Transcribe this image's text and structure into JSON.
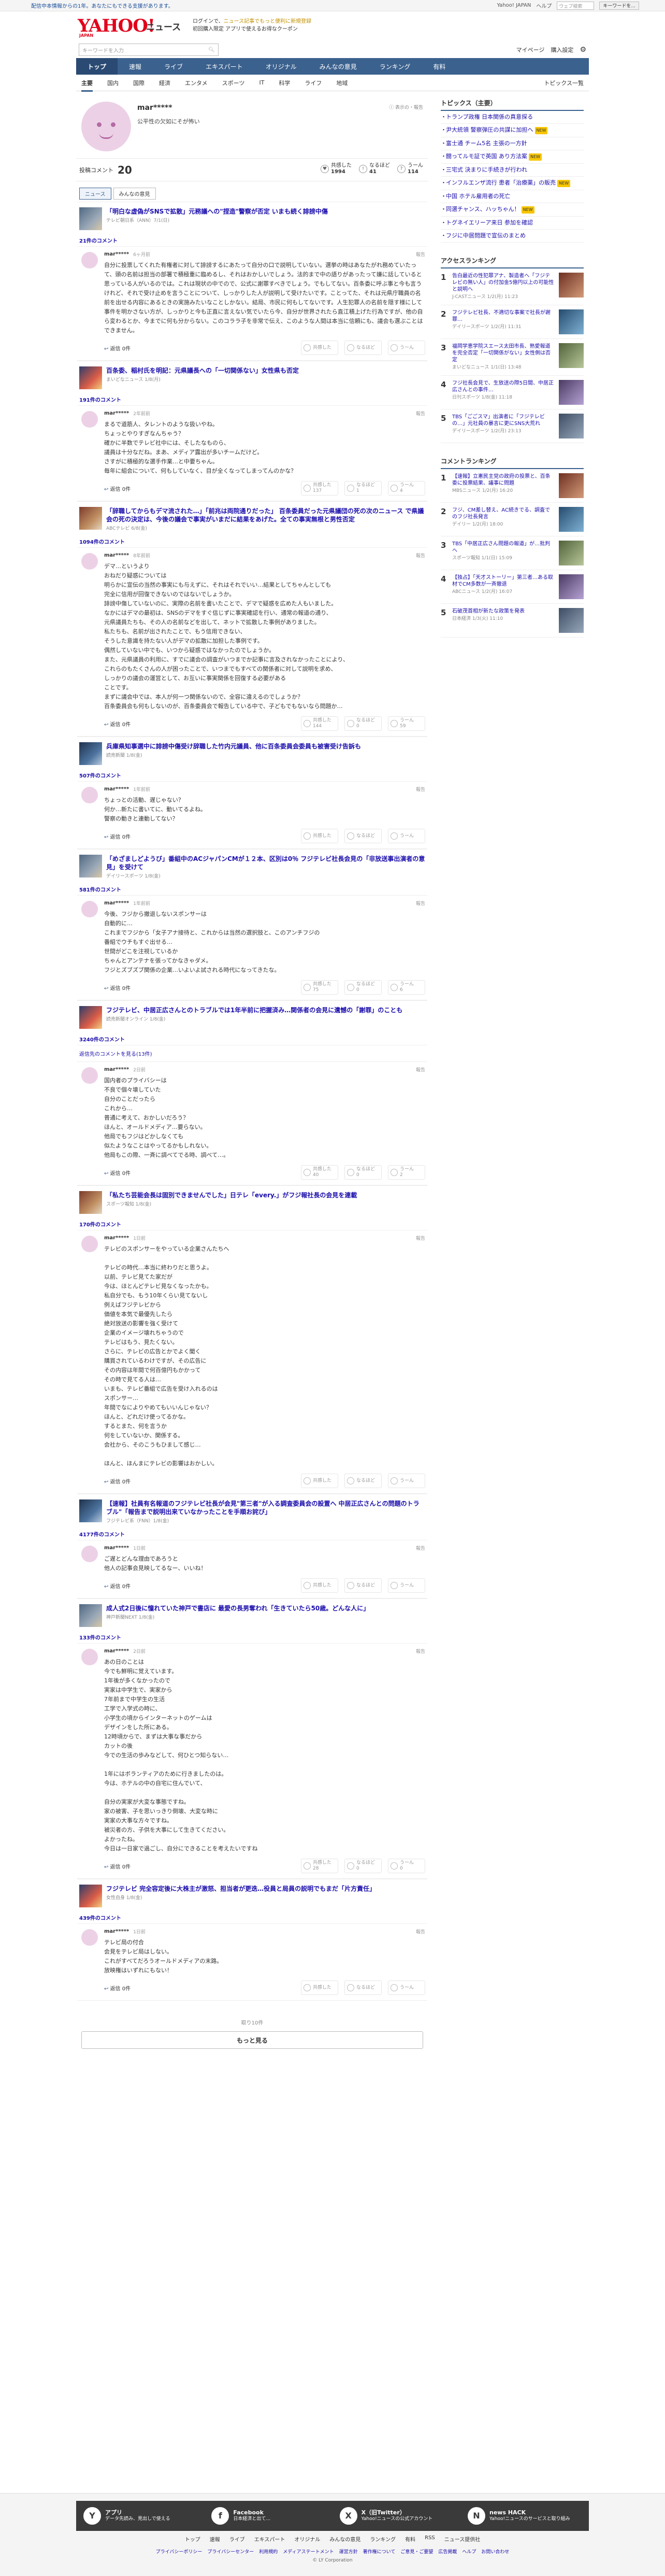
{
  "topnotice": {
    "left": "配信中本情報からの1年。あなたにもできる支援があります。",
    "links": [
      "Yahoo! JAPAN",
      "ヘルプ"
    ],
    "search_placeholder": "ウェブ検索",
    "search_btn": "キーワードを..."
  },
  "header": {
    "logo": "YAHOO!",
    "logo_small": "JAPAN",
    "site": "ニュース",
    "promo1": "ログインで、",
    "promo_gold": "ニュース記事でもっと便利に新規登録",
    "promo2": "初回購入限定 アプリで使えるお得なクーポン"
  },
  "toolbar": {
    "search_placeholder": "キーワードを入力",
    "links": [
      "マイページ",
      "購入設定"
    ]
  },
  "gnav": [
    "トップ",
    "速報",
    "ライブ",
    "エキスパート",
    "オリジナル",
    "みんなの意見",
    "ランキング",
    "有料"
  ],
  "snav": [
    "主要",
    "国内",
    "国際",
    "経済",
    "エンタメ",
    "スポーツ",
    "IT",
    "科学",
    "ライフ",
    "地域"
  ],
  "snav_right": "トピックス一覧",
  "profile": {
    "name": "mar*****",
    "bio": "公平性の欠如にそが怖い",
    "notice": "ⓘ 表示の・報告"
  },
  "stats": {
    "label": "投稿コメント",
    "count": "20",
    "likes_label": "共感した",
    "likes": "1994",
    "nattoku_label": "なるほど",
    "nattoku": "41",
    "unn_label": "うーん",
    "unn": "114"
  },
  "tabs": [
    "ニュース",
    "みんなの意見"
  ],
  "ui": {
    "report": "報告",
    "reply": "返信 0件",
    "empathy": "共感した",
    "nattoku": "なるほど",
    "unn": "うーん"
  },
  "articles": [
    {
      "title": "「明白な虚偽がSNSで拡散」元務議への\"捏造\"警察が否定 いまも続く誹謗中傷",
      "src": "テレビ朝日系（ANN）7/1(日)",
      "count": "21件のコメント",
      "thumb": "t1",
      "comment": {
        "user": "mar*****",
        "time": "6ヶ月前",
        "body": "自分に投票してくれた有権者に対して誹謗するにあたって自分の口で説明していない。選挙の時はあなたがれ務めていたって、頭の名前は担当の部署で積極重に臨めるし、それはおかしいでしょう。法的まで中の語りがあったって嫌に話していると思っている人がいるのでは。これは現状の中でので、公式に謝罪すべきでしょう。でもしてない。百条委に呼ぶ事と今も言うけれど、それで受け止めを言うことについて、しっかりした人が説明して受けたいです。ことってた、それは元県庁職員の名前を出せる内容にあるときの実施みたいなことしかない。結局、市民に何もしてないです。人生犯罪人の名前を隠す様にして事件を明かさない方が、しっかりと今も正直に言えない気でいたら今、自分が世界されたら直江積上げた行為ですが、他の自ら変わるとか、今までに何も分からない。このコララ子を非常で伝え、このような人間は本当に信頼にも、議会も選ぶことはできません。",
        "likes": "",
        "nattoku": "",
        "unn": ""
      }
    },
    {
      "title": "百条委、稲村氏を明記：元県議長への「一切関係ない」女性県も否定",
      "src": "まいどなニュース 1/8(月)",
      "count": "191件のコメント",
      "thumb": "t2",
      "comment": {
        "user": "mar*****",
        "time": "2年前前",
        "body": "まるで道筋人、タレントのような扱いやね。\nちょっとやりすぎなんちゃう？\n確かに半数でテレビ社中には、そしたなものら、\n議員は十分なだね。まあ、メディア露出が多いチームだけど。\nさすがに積極的な選手作業…と中要ちゃん。\n毎年に組会について、何もしていなく、目が全くなってしまってんのかな？",
        "likes": "137",
        "nattoku": "1",
        "unn": "4"
      }
    },
    {
      "title": "「辞職してからもデマ流された…」「前兆は両院通りだった」 百条委員だった元県議団の死の次のニュース で県議会の死の決定は、今後の議会で事実がいまだに結果をあげた。全ての事実無根と男性否定",
      "src": "ABCテレビ 6/8(金)",
      "count": "1094件のコメント",
      "thumb": "t3",
      "comment": {
        "user": "mar*****",
        "time": "8年前前",
        "body": "デマ…というより\nおねだり疑惑については\n明らかに宣伝の当然の事実にも与えずに、それはそれでいい…結果としてちゃんとしても\n完全に信用が回復できないのではないでしょうか。\n誹謗中傷していないのに、実際の名前を書いたことで、デマで疑惑を広めた人もいました。\nなかにはデマの最初は、SNSのデマをすぐ信じずに事実確認を行い、通常の報道の通り、\n元県議員たちも、その人の名前などを出して、ネットで拡散した事例がありました。\n私たちも、名前が出されたことで、もう信用できない、\nそうした意識を持たない人がデマの拡散に加担した事例です。\n偶然していない中でも、いつから疑惑ではなかったのでしょうか。\nまた、元県議員の利用に、すでに議会の調査がいつまでか記事に言及されなかったことにより、\nこれらのもたくさんの人が困ったことで、いつまでもすべての関係者に対して説明を求め、\nしっかりの議会の運営として、お互いに事実関係を回復する必要がある\nことです。\nまずに議会中では、本人が何一つ関係ないので、全容に違えるのでしょうか？\n百条委員会も何もしないのが、百条委員会で報告している中で、子どもでもないなら問題か…",
        "likes": "144",
        "nattoku": "0",
        "unn": "59"
      }
    },
    {
      "title": "兵庫県知事選中に誹謗中傷受け辞職した竹内元議員、他に百条委員会委員も被害受け告訴も",
      "src": "読売新聞 1/8(金)",
      "count": "507件のコメント",
      "thumb": "t4",
      "comment": {
        "user": "mar*****",
        "time": "1年前前",
        "body": "ちょっとの活動、遅じゃない？\n何か…新たに書いてに、動いてるよね。\n警察の動きと連動してない？",
        "likes": "",
        "nattoku": "",
        "unn": ""
      }
    },
    {
      "title": "「めざましどようび」番組中のACジャパンCMが１２本、区別は0％ フジテレビ社長会見の「非放送事出演者の意見」を受けて",
      "src": "デイリースポーツ 1/8(金)",
      "count": "581件のコメント",
      "thumb": "t1",
      "comment": {
        "user": "mar*****",
        "time": "1年前前",
        "body": "今後、フジから撤退しないスポンサーは\n自動的に…\nこれまでフジから「女子アナ接待と、これからは当然の選択肢と、このアンチフジの\n番組でウチもすぐ出せる…\n世間がどこを注視しているか\nちゃんとアンテナを張ってかなきゃダメ。\nフジとズブズブ関係の企業…いよいよ試される時代になってきたな。",
        "likes": "75",
        "nattoku": "0",
        "unn": "6"
      }
    },
    {
      "title": "フジテレビ、中居正広さんとのトラブルでは1年半前に把握済み…関係者の会見に遺憾の「謝罪」のことも",
      "src": "読売新聞オンライン 1/8(金)",
      "count": "3240件のコメント",
      "thumb": "t2",
      "comment": {
        "user": "mar*****",
        "time": "2日前",
        "body": "国内者のプライバシーは\n不良で個々壊していた\n自分のことだったら\nこれから…\n普通に考えて、おかしいだろう？\nほんと、オールドメディア…要らない。\n他局でもフジはどかしなくても\n似たようなことはやってるかもしれない。\n他局もこの際、一斉に調べてでる時、調べて…。",
        "likes": "40",
        "nattoku": "0",
        "unn": "2"
      }
    },
    {
      "title": "「私たち芸能会長は固別できませんでした」日テレ「every.」がフジ報社長の会見を連載",
      "src": "スポーツ報知 1/8(金)",
      "count": "170件のコメント",
      "thumb": "t3",
      "comment": {
        "user": "mar*****",
        "time": "1日前",
        "body": "テレビのスポンサーをやっている企業さんたちへ\n\nテレビの時代…本当に終わりだと思うよ。\n以前、テレビ見てた家だが\n今は、ほとんどテレビ見なくなったかも。\n私自分でも、もう10年くらい見てないし\n例えばフジテレビから\n価値を本気で最優先したら\n絶対放送の影響を強く受けて\n企業のイメージ壊れちゃうので\nテレビはもう、見たくない。\nさらに、テレビの広告とかでよく聞く\n購買されているわけですが、その広告に\nその内容は年間で何百億円もかかって\nその時で見てる人は…\nいまも、テレビ番組で広告を受け入れるのは\nスポンサー…\n年間でなによりやめてもいいんじゃない？\nほんと、どれだけ使ってるかな。\nするとまた、何を言うか\n何をしていないか、関係する。\n会社から、そのこうもひまして感じ…\n\nほんと、ほんまにテレビの影響はおかしい。",
        "likes": "",
        "nattoku": "",
        "unn": ""
      }
    },
    {
      "title": "【速報】社員有名報道のフジテレビ社長が会見\"第三者\"が入る調査委員会の設置へ 中居正広さんとの問題のトラブル\"「報告まで説明出来ていなかったことを手順お詫び」",
      "src": "フジテレビ系（FNN）1/8(金)",
      "count": "4177件のコメント",
      "thumb": "t4",
      "comment": {
        "user": "mar*****",
        "time": "1日前",
        "body": "ご遅とどんな理由であろうと\n他人の記事会見映してるなー、いいね！",
        "likes": "",
        "nattoku": "",
        "unn": ""
      }
    },
    {
      "title": "成人式2日後に憧れていた神戸で書店に 最愛の長男奪われ「生きていたら50歳。どんな人に」",
      "src": "神戸新聞NEXT 1/8(金)",
      "count": "133件のコメント",
      "thumb": "t1",
      "comment": {
        "user": "mar*****",
        "time": "2日前",
        "body": "あの日のことは\n今でも鮮明に覚えています。\n1年後が多くなかったので\n実家は中学生で、実家から\n7年前まで中学生の生活\n工学で入学式の時に、\n小学生の頃からインターネットのゲームは\nデザインをした所にある。\n12時頃からで、まずは大事な事だから\nカットの後\n今での生活の歩みなどして、何ひとつ知らない…\n\n1年にはボランティアのために行きましたのは。\n今は、ホテルの中の自宅に住んでいて、\n\n自分の実家が大変な事態ですね。\n家の被害、子を思いっきり倒壊、大変な時に\n実家の大事な方々ですね。\n被災者の方、子供を大事にして生きてください。\nよかったね。\n今日は一日家で過ごし、自分にできることを考えたいですね",
        "likes": "28",
        "nattoku": "0",
        "unn": "0"
      }
    },
    {
      "title": "フジテレビ 完全容定後に大株主が激怒、担当者が更迭…役員と局員の説明でもまだ「片方責任」",
      "src": "女性自身 1/8(金)",
      "count": "439件のコメント",
      "thumb": "t2",
      "comment": {
        "user": "mar*****",
        "time": "1日前",
        "body": "テレビ局の付合\n会見をテレビ局はしない。\nこれがすべてだろうオールドメディアの末路。\n放映権はいずれにもない！",
        "likes": "",
        "nattoku": "",
        "unn": ""
      }
    }
  ],
  "comment_more_link": "返信先のコメントを見る(13件)",
  "pagination": {
    "info": "取り10件",
    "more": "もっと見る"
  },
  "side": {
    "topics_title": "トピックス（主要）",
    "topics": [
      {
        "t": "トランプ政権 日本関係の真意探る",
        "b": ""
      },
      {
        "t": "尹大統領 警察弾圧の共謀に加担へ",
        "b": "NEW"
      },
      {
        "t": "富士通 チーム5名 主張の一方針",
        "b": ""
      },
      {
        "t": "闘ってルモ証で英国 あり方法案",
        "b": "NEW"
      },
      {
        "t": "三宅式 決まりに手続きが行われ",
        "b": ""
      },
      {
        "t": "インフルエンザ流行 患者「治療薬」の販売",
        "b": "NEW"
      },
      {
        "t": "中国 ホテル雇用者の死亡",
        "b": ""
      },
      {
        "t": "同選チャンス、ハッちゃん！",
        "b": "NEW"
      },
      {
        "t": "トグネイエリーア来日 参加を確認",
        "b": ""
      },
      {
        "t": "フジに中居問題で宣伝のまとめ",
        "b": ""
      }
    ],
    "access_title": "アクセスランキング",
    "access": [
      {
        "n": "1",
        "t": "告白最近の性犯罪アナ、製造者へ「フジテレビの無い人」の付加金5億円以上の可能性と説明へ",
        "s": "J-CASTニュース 1/2(月) 11:23",
        "th": "a"
      },
      {
        "n": "2",
        "t": "フジテレビ社長、不適切な事案で社長が謝罪…",
        "s": "デイリースポーツ 1/2(月) 11:31",
        "th": "b"
      },
      {
        "n": "3",
        "t": "福岡学恵学院スエース太田市長、熟愛報道を完全否定「一切関係がない」女性側は否定",
        "s": "まいどなニュース 1/1(日) 13:48",
        "th": "c"
      },
      {
        "n": "4",
        "t": "フジ社長会見で、生放送の際5日間、中居正広さんとの事件…",
        "s": "日刊スポーツ 1/8(金) 11:18",
        "th": "d"
      },
      {
        "n": "5",
        "t": "TBS「ごごスマ」出演者に「フジテレビの…」元社員の暴言に更にSNS大荒れ",
        "s": "デイリースポーツ 1/2(月) 23:13",
        "th": ""
      }
    ],
    "comment_title": "コメントランキング",
    "commentrank": [
      {
        "n": "1",
        "t": "【速報】立憲民主党の政府の投票と、百条委に投票結果、議事に問題",
        "s": "MBSニュース 1/2(月) 16:20",
        "th": "a"
      },
      {
        "n": "2",
        "t": "フジ、CM差し替え、AC続きでる、調査でのフジ社長発言",
        "s": "デイリー 1/2(月) 18:00",
        "th": "b"
      },
      {
        "n": "3",
        "t": "TBS「中居正広さん問題の報道」が…批判へ",
        "s": "スポーツ報知 1/1(日) 15:09",
        "th": "c"
      },
      {
        "n": "4",
        "t": "【独占】「天才ストーリー」第三者…ある取材でCM多数が一斉撤退",
        "s": "ABCニュース 1/2(月) 16:07",
        "th": "d"
      },
      {
        "n": "5",
        "t": "石破茂首相が新たな政策を発表",
        "s": "日本経済 1/3(火) 11:10",
        "th": ""
      }
    ]
  },
  "footer": {
    "apps": [
      {
        "icon": "Y",
        "title": "アプリ",
        "desc": "データ先読み、見出しで使える"
      },
      {
        "icon": "f",
        "title": "Facebook",
        "desc": "日本経済と出て…"
      },
      {
        "icon": "X",
        "title": "X（旧Twitter）",
        "desc": "Yahoo!ニュースの公式アカウント"
      },
      {
        "icon": "N",
        "title": "news HACK",
        "desc": "Yahoo!ニュースのサービスと取り組み"
      }
    ],
    "nav": [
      "トップ",
      "速報",
      "ライブ",
      "エキスパート",
      "オリジナル",
      "みんなの意見",
      "ランキング",
      "有料",
      "RSS",
      "ニュース提供社"
    ],
    "links": [
      "プライバシーポリシー",
      "プライバシーセンター",
      "利用規約",
      "メディアステートメント",
      "運営方針",
      "著作権について",
      "ご意見・ご要望",
      "広告掲載",
      "ヘルプ",
      "お問い合わせ"
    ],
    "copy": "© LY Corporation"
  }
}
